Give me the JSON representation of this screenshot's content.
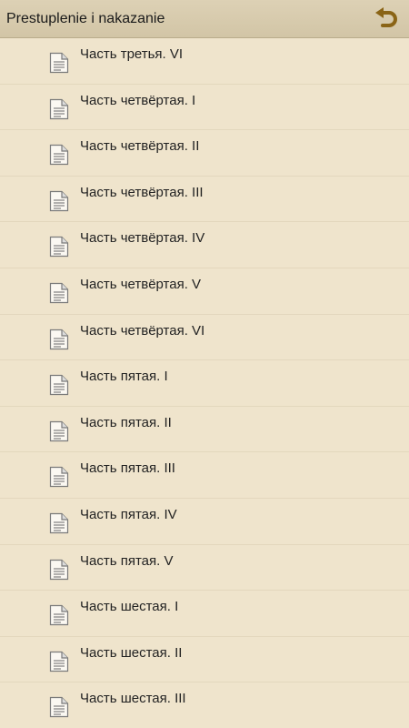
{
  "header": {
    "title": "Prestuplenie i nakazanie",
    "back_icon": "undo-arrow-icon"
  },
  "list": {
    "item_icon": "document-icon",
    "items": [
      {
        "label": "Часть третья. VI"
      },
      {
        "label": "Часть четвёртая. I"
      },
      {
        "label": "Часть четвёртая. II"
      },
      {
        "label": "Часть четвёртая. III"
      },
      {
        "label": "Часть четвёртая. IV"
      },
      {
        "label": "Часть четвёртая. V"
      },
      {
        "label": "Часть четвёртая. VI"
      },
      {
        "label": "Часть пятая. I"
      },
      {
        "label": "Часть пятая. II"
      },
      {
        "label": "Часть пятая. III"
      },
      {
        "label": "Часть пятая. IV"
      },
      {
        "label": "Часть пятая. V"
      },
      {
        "label": "Часть шестая. I"
      },
      {
        "label": "Часть шестая. II"
      },
      {
        "label": "Часть шестая. III"
      }
    ]
  },
  "colors": {
    "background": "#efe4cc",
    "header": "#d6c9ab",
    "accent": "#8a6416"
  }
}
